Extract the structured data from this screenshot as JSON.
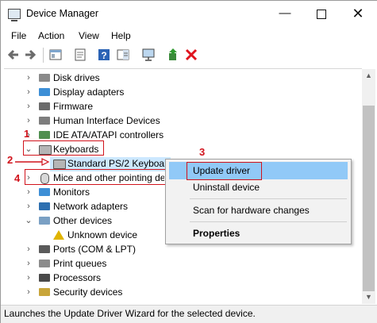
{
  "window": {
    "title": "Device Manager",
    "minimize": "—",
    "close": "✕"
  },
  "menu": [
    "File",
    "Action",
    "View",
    "Help"
  ],
  "toolbar": [
    "back-icon",
    "forward-icon",
    "show-hide-icon",
    "properties-icon",
    "help-icon",
    "action-pane-icon",
    "scan-icon",
    "update-driver-icon",
    "uninstall-icon"
  ],
  "tree": {
    "items": [
      {
        "label": "Disk drives",
        "expander": "›"
      },
      {
        "label": "Display adapters",
        "expander": "›"
      },
      {
        "label": "Firmware",
        "expander": "›"
      },
      {
        "label": "Human Interface Devices",
        "expander": "›"
      },
      {
        "label": "IDE ATA/ATAPI controllers",
        "expander": "›"
      },
      {
        "label": "Keyboards",
        "expander": "⌄"
      },
      {
        "label": "Standard PS/2 Keyboard",
        "expander": ""
      },
      {
        "label": "Mice and other pointing devices",
        "expander": "›"
      },
      {
        "label": "Monitors",
        "expander": "›"
      },
      {
        "label": "Network adapters",
        "expander": "›"
      },
      {
        "label": "Other devices",
        "expander": "⌄"
      },
      {
        "label": "Unknown device",
        "expander": ""
      },
      {
        "label": "Ports (COM & LPT)",
        "expander": "›"
      },
      {
        "label": "Print queues",
        "expander": "›"
      },
      {
        "label": "Processors",
        "expander": "›"
      },
      {
        "label": "Security devices",
        "expander": "›"
      }
    ]
  },
  "context_menu": {
    "update_driver": "Update driver",
    "uninstall": "Uninstall device",
    "scan": "Scan for hardware changes",
    "properties": "Properties"
  },
  "annotations": {
    "n1": "1",
    "n2": "2",
    "n3": "3",
    "n4": "4"
  },
  "status": "Launches the Update Driver Wizard for the selected device.",
  "colors": {
    "selection": "#cce8ff",
    "menu_highlight": "#91c9f7",
    "annotation_red": "#d1131c"
  }
}
